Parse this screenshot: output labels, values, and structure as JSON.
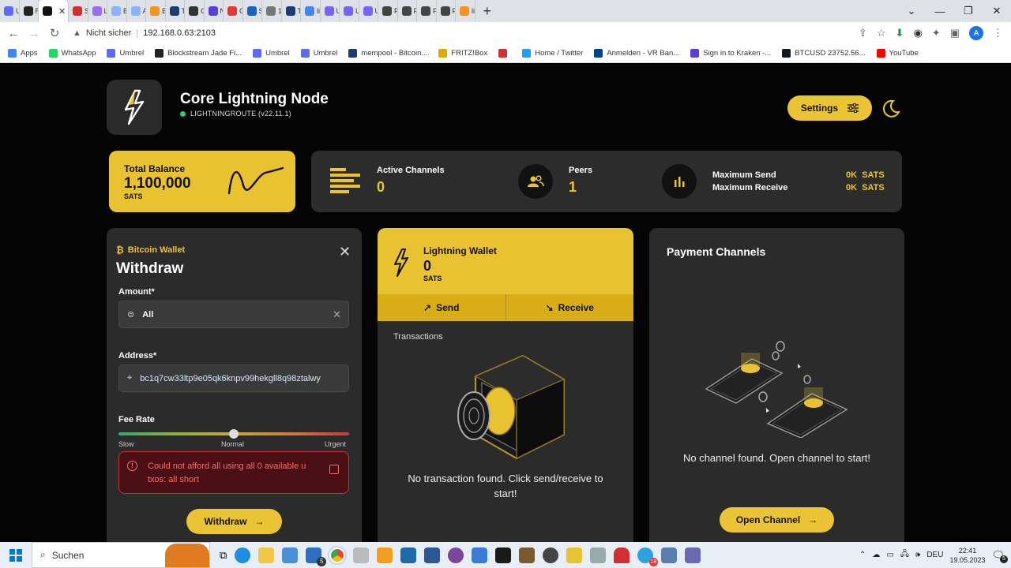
{
  "browser": {
    "tabs": [
      {
        "label": "Un",
        "color": "#5b6bf5"
      },
      {
        "label": "RT",
        "color": "#222222"
      },
      {
        "label": "",
        "color": "#111111",
        "active": true
      },
      {
        "label": "Sp",
        "color": "#d32f2f"
      },
      {
        "label": "Lig",
        "color": "#9c6cf5"
      },
      {
        "label": "Bit",
        "color": "#8ab4f8"
      },
      {
        "label": "Ad",
        "color": "#8ab4f8"
      },
      {
        "label": "Bit",
        "color": "#f7931a"
      },
      {
        "label": "Tre",
        "color": "#1f3b73"
      },
      {
        "label": "Co",
        "color": "#333333"
      },
      {
        "label": "Nc",
        "color": "#5b3fd8"
      },
      {
        "label": "CC",
        "color": "#e53935"
      },
      {
        "label": "Se",
        "color": "#1565c0"
      },
      {
        "label": "10",
        "color": "#777777"
      },
      {
        "label": "Tre",
        "color": "#1f3b73"
      },
      {
        "label": "lig",
        "color": "#4285f4"
      },
      {
        "label": "Un",
        "color": "#7b61ff"
      },
      {
        "label": "Un",
        "color": "#7b61ff"
      },
      {
        "label": "Un",
        "color": "#7b61ff"
      },
      {
        "label": "FA",
        "color": "#444444"
      },
      {
        "label": "FA",
        "color": "#444444"
      },
      {
        "label": "FA",
        "color": "#444444"
      },
      {
        "label": "FA",
        "color": "#444444"
      },
      {
        "label": "lig",
        "color": "#f7931a"
      }
    ],
    "close_glyph": "✕",
    "new_tab_glyph": "+",
    "security_label": "Nicht sicher",
    "url": "192.168.0.63:2103",
    "avatar_letter": "A",
    "bookmarks": [
      {
        "label": "Apps",
        "color": "#4285f4"
      },
      {
        "label": "WhatsApp",
        "color": "#25d366"
      },
      {
        "label": "Umbrel",
        "color": "#5b6bf5"
      },
      {
        "label": "Blockstream Jade Fi...",
        "color": "#222222"
      },
      {
        "label": "Umbrel",
        "color": "#5b6bf5"
      },
      {
        "label": "Umbrel",
        "color": "#5b6bf5"
      },
      {
        "label": "mempool - Bitcoin...",
        "color": "#1f3b73"
      },
      {
        "label": "FRITZ!Box",
        "color": "#e2a700"
      },
      {
        "label": "",
        "color": "#d32f2f"
      },
      {
        "label": "Home / Twitter",
        "color": "#1da1f2"
      },
      {
        "label": "Anmelden - VR Ban...",
        "color": "#00428c"
      },
      {
        "label": "Sign in to Kraken -...",
        "color": "#5741d9"
      },
      {
        "label": "BTCUSD 23752.56...",
        "color": "#131722"
      },
      {
        "label": "YouTube",
        "color": "#ff0000"
      }
    ]
  },
  "header": {
    "title": "Core Lightning Node",
    "subtitle": "LIGHTNINGROUTE (v22.11.1)",
    "settings_label": "Settings"
  },
  "balance": {
    "label": "Total Balance",
    "value": "1,100,000",
    "unit": "SATS"
  },
  "stats": {
    "active_channels_label": "Active Channels",
    "active_channels_value": "0",
    "peers_label": "Peers",
    "peers_value": "1",
    "max_send_label": "Maximum Send",
    "max_receive_label": "Maximum Receive",
    "max_send_value": "0K",
    "max_receive_value": "0K",
    "unit": "SATS"
  },
  "bitcoin_wallet": {
    "header": "Bitcoin Wallet",
    "title": "Withdraw",
    "amount_label": "Amount*",
    "amount_value": "All",
    "address_label": "Address*",
    "address_value": "bc1q7cw33ltp9e05qk6knpv99hekgll8q98ztalwy",
    "fee_label": "Fee Rate",
    "fee_level": 0.5,
    "fee_slow": "Slow",
    "fee_normal": "Normal",
    "fee_urgent": "Urgent",
    "error_line1": "Could not afford all using all 0 available u",
    "error_line2": "txos: all short",
    "button_label": "Withdraw"
  },
  "lightning_wallet": {
    "title": "Lightning Wallet",
    "value": "0",
    "unit": "SATS",
    "send_label": "Send",
    "receive_label": "Receive",
    "transactions_label": "Transactions",
    "empty_line1": "No transaction found. Click send/receive to",
    "empty_line2": "start!"
  },
  "payment_channels": {
    "title": "Payment Channels",
    "empty_message": "No channel found. Open channel to start!",
    "button_label": "Open Channel"
  },
  "taskbar": {
    "search_label": "Suchen",
    "language": "DEU",
    "time": "22:41",
    "date": "19.05.2023",
    "notification_count": "5",
    "edge_badge": "5",
    "app_badge": "18"
  }
}
